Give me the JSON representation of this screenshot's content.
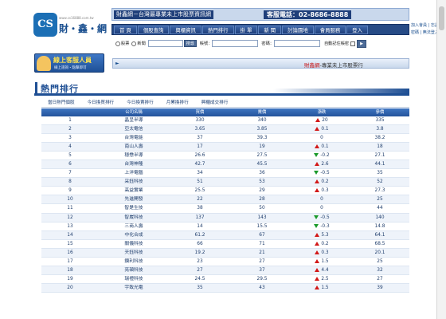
{
  "logo": {
    "mark": "CS",
    "url": "www.cs16888.com.tw",
    "name": "財・鑫・網"
  },
  "topbar": {
    "slogan": "財鑫網－台灣最專業未上市股票資訊網",
    "phone": "客服電話：02-8686-8888"
  },
  "nav": {
    "items": [
      "首 頁",
      "個股查詢",
      "興櫃資訊",
      "熱門排行",
      "掛 單",
      "新 聞",
      "討論園地",
      "會員服務",
      "登入"
    ]
  },
  "header_links": [
    "加入會員 | 忘記",
    "密碼 | 無法登入"
  ],
  "search": {
    "radio_stock": "股票",
    "radio_news": "新聞",
    "search_button": "搜尋",
    "account_label": "帳號：",
    "password_label": "密碼：",
    "remember_label": "自動記住帳密"
  },
  "service": {
    "title": "線上客服人員",
    "subtitle": "線上諮詢・點擊即可"
  },
  "marquee": {
    "brand": "財鑫網",
    "text": "-專業未上市股票行"
  },
  "section": {
    "title": "熱門排行"
  },
  "subtabs": [
    "當日熱門個股",
    "今日換買排行",
    "今日換賣排行",
    "月累換排行",
    "興櫃成交排行"
  ],
  "table": {
    "headers": [
      "",
      "公司名稱",
      "買價",
      "賣價",
      "漲跌",
      "參價"
    ],
    "rows": [
      {
        "no": "1",
        "name": "晶呈半導",
        "buy": "330",
        "sell": "340",
        "dir": "up",
        "chg": "20",
        "ref": "335"
      },
      {
        "no": "2",
        "name": "亞太電信",
        "buy": "3.65",
        "sell": "3.85",
        "dir": "up",
        "chg": "0.1",
        "ref": "3.8"
      },
      {
        "no": "3",
        "name": "台灣電能",
        "buy": "37",
        "sell": "39.3",
        "dir": "flat",
        "chg": "0",
        "ref": "38.2"
      },
      {
        "no": "4",
        "name": "南山人壽",
        "buy": "17",
        "sell": "19",
        "dir": "up",
        "chg": "0.1",
        "ref": "18"
      },
      {
        "no": "5",
        "name": "穩懋半導",
        "buy": "26.6",
        "sell": "27.5",
        "dir": "down",
        "chg": "-0.2",
        "ref": "27.1"
      },
      {
        "no": "6",
        "name": "台灣神隆",
        "buy": "42.7",
        "sell": "45.5",
        "dir": "up",
        "chg": "2.6",
        "ref": "44.1"
      },
      {
        "no": "7",
        "name": "上洋電腦",
        "buy": "34",
        "sell": "36",
        "dir": "down",
        "chg": "-0.5",
        "ref": "35"
      },
      {
        "no": "8",
        "name": "采鈺科技",
        "buy": "51",
        "sell": "53",
        "dir": "up",
        "chg": "0.2",
        "ref": "52"
      },
      {
        "no": "9",
        "name": "高益實業",
        "buy": "25.5",
        "sell": "29",
        "dir": "up",
        "chg": "0.3",
        "ref": "27.3"
      },
      {
        "no": "10",
        "name": "先進開發",
        "buy": "22",
        "sell": "28",
        "dir": "flat",
        "chg": "0",
        "ref": "25"
      },
      {
        "no": "11",
        "name": "智是生技",
        "buy": "38",
        "sell": "50",
        "dir": "flat",
        "chg": "0",
        "ref": "44"
      },
      {
        "no": "12",
        "name": "智崴科技",
        "buy": "137",
        "sell": "143",
        "dir": "down",
        "chg": "-0.5",
        "ref": "140"
      },
      {
        "no": "13",
        "name": "三商人壽",
        "buy": "14",
        "sell": "15.5",
        "dir": "down",
        "chg": "-0.3",
        "ref": "14.8"
      },
      {
        "no": "14",
        "name": "中化合成",
        "buy": "61.2",
        "sell": "67",
        "dir": "up",
        "chg": "5.3",
        "ref": "64.1"
      },
      {
        "no": "15",
        "name": "關儀科技",
        "buy": "66",
        "sell": "71",
        "dir": "up",
        "chg": "0.2",
        "ref": "68.5"
      },
      {
        "no": "16",
        "name": "天鈺科技",
        "buy": "19.2",
        "sell": "21",
        "dir": "up",
        "chg": "0.3",
        "ref": "20.1"
      },
      {
        "no": "17",
        "name": "鑽利科技",
        "buy": "23",
        "sell": "27",
        "dir": "up",
        "chg": "1.5",
        "ref": "25"
      },
      {
        "no": "18",
        "name": "亮碩科技",
        "buy": "27",
        "sell": "37",
        "dir": "up",
        "chg": "4.4",
        "ref": "32"
      },
      {
        "no": "19",
        "name": "瑞禮科技",
        "buy": "24.5",
        "sell": "29.5",
        "dir": "up",
        "chg": "2.5",
        "ref": "27"
      },
      {
        "no": "20",
        "name": "宇致光電",
        "buy": "35",
        "sell": "43",
        "dir": "up",
        "chg": "1.5",
        "ref": "39"
      }
    ]
  },
  "colors": {
    "nav": "#274b86",
    "up": "#d21818",
    "down": "#1a9a2a",
    "header": "#24539b"
  }
}
